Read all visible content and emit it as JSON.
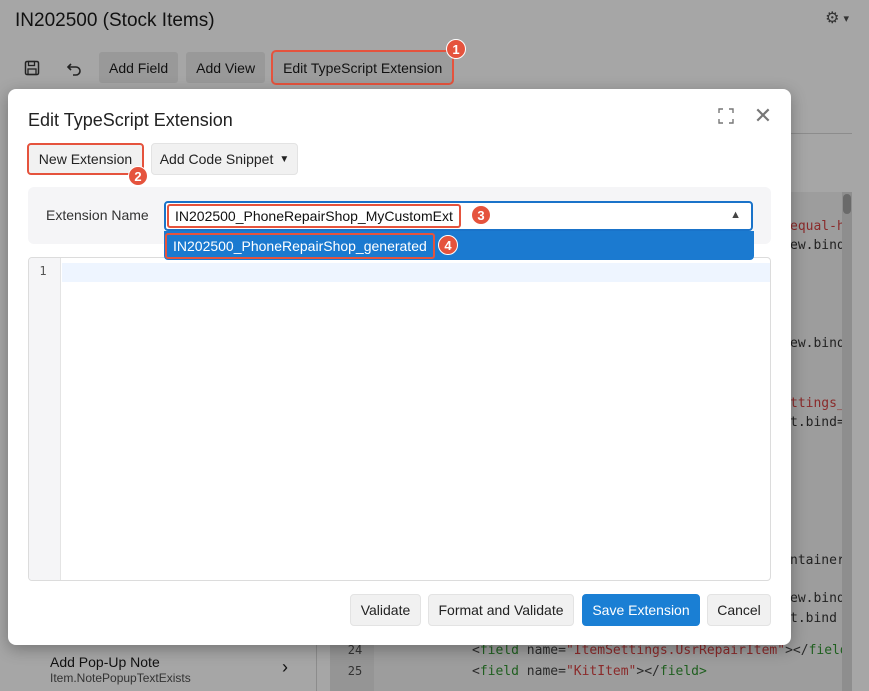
{
  "app": {
    "title": "IN202500 (Stock Items)",
    "toolbar": {
      "add_field": "Add Field",
      "add_view": "Add View",
      "edit_ts": "Edit TypeScript Extension"
    },
    "left_item": {
      "title": "Add Pop-Up Note",
      "subtitle": "Item.NotePopupTextExists"
    },
    "code": {
      "line_numbers": [
        "24",
        "25"
      ],
      "lines": [
        [
          "<",
          "field",
          " name=",
          "\"ItemSettings.UsrRepairItem\"",
          "></",
          "field"
        ],
        [
          "<",
          "field",
          " name=",
          "\"KitItem\"",
          "></",
          "field>"
        ]
      ],
      "right_fragments": [
        {
          "text": "equal-h",
          "color": "red"
        },
        {
          "text": "ew.bind",
          "color": "dark"
        },
        {
          "text": "ew.bind",
          "color": "dark"
        },
        {
          "text": "ttings_",
          "color": "red"
        },
        {
          "text": "t.bind=",
          "color": "dark"
        },
        {
          "text": "ntainer",
          "color": "dark"
        },
        {
          "text": "ew.bind",
          "color": "dark"
        },
        {
          "text": "t.bind",
          "color": "dark"
        }
      ]
    }
  },
  "markers": [
    "1",
    "2",
    "3",
    "4"
  ],
  "dialog": {
    "title": "Edit TypeScript Extension",
    "new_extension": "New Extension",
    "add_code_snippet": "Add Code Snippet",
    "extension_name_label": "Extension Name",
    "extension_name_value": "IN202500_PhoneRepairShop_MyCustomExt",
    "dropdown_option": "IN202500_PhoneRepairShop_generated",
    "editor_line": "1",
    "validate": "Validate",
    "format_validate": "Format and Validate",
    "save_extension": "Save Extension",
    "cancel": "Cancel"
  },
  "colors": {
    "accent": "#1a7fd4",
    "highlight": "#e5533d"
  },
  "icons": {
    "save": "save-icon",
    "undo": "undo-icon",
    "settings": "gear-icon",
    "expand": "expand-icon",
    "close": "close-icon"
  }
}
